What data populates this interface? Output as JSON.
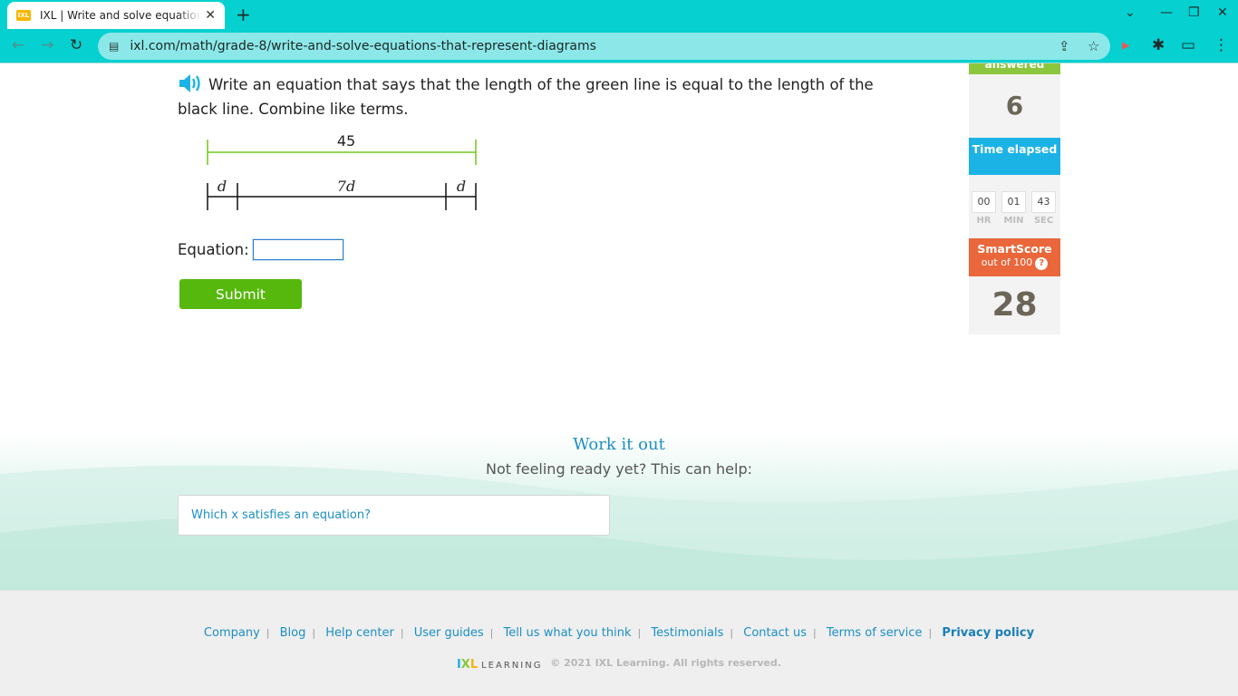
{
  "browser": {
    "tab_title": "IXL | Write and solve equations that represent diagrams",
    "favicon_text": "IXL",
    "url": "ixl.com/math/grade-8/write-and-solve-equations-that-represent-diagrams",
    "theme_color": "#06d0d0"
  },
  "question": {
    "text": "Write an equation that says that the length of the green line is equal to the length of the black line. Combine like terms.",
    "green_label": "45",
    "segments": [
      "d",
      "7d",
      "d"
    ],
    "equation_label": "Equation:",
    "equation_value": "",
    "submit_label": "Submit"
  },
  "sidebar": {
    "answered_label": "answered",
    "questions_answered": "6",
    "time_label": "Time elapsed",
    "timer": [
      {
        "value": "00",
        "unit": "HR"
      },
      {
        "value": "01",
        "unit": "MIN"
      },
      {
        "value": "43",
        "unit": "SEC"
      }
    ],
    "smartscore_title": "SmartScore",
    "smartscore_sub": "out of 100",
    "smartscore_help": "?",
    "smartscore": "28",
    "colors": {
      "answered": "#8cc63f",
      "time": "#1bb3e5",
      "smartscore": "#e9673b"
    }
  },
  "work_it_out": {
    "title": "Work it out",
    "subtitle": "Not feeling ready yet? This can help:",
    "link": "Which x satisfies an equation?"
  },
  "footer": {
    "links": [
      "Company",
      "Blog",
      "Help center",
      "User guides",
      "Tell us what you think",
      "Testimonials",
      "Contact us",
      "Terms of service",
      "Privacy policy"
    ],
    "logo_ixl": "IXL",
    "logo_learning": "LEARNING",
    "copyright": "© 2021 IXL Learning. All rights reserved."
  }
}
